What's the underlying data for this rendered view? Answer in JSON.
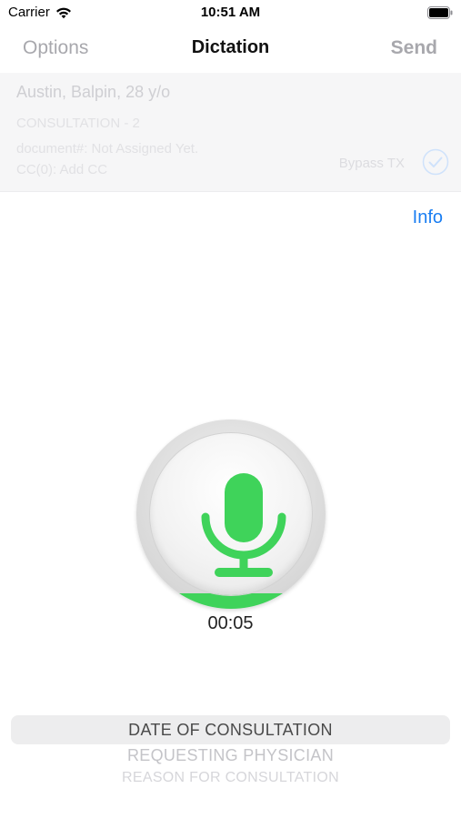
{
  "status_bar": {
    "carrier": "Carrier",
    "time": "10:51 AM"
  },
  "nav": {
    "options_label": "Options",
    "title": "Dictation",
    "send_label": "Send"
  },
  "patient": {
    "name": "Austin, Balpin, 28 y/o",
    "consultation": "CONSULTATION - 2",
    "document": "document#: Not Assigned Yet.",
    "cc": "CC(0): Add CC",
    "bypass_label": "Bypass TX",
    "bypass_checked": true
  },
  "info_label": "Info",
  "recorder": {
    "timer": "00:05",
    "level_percent": 8,
    "accent_color": "#3fd35a"
  },
  "sections": {
    "items": [
      "DATE OF CONSULTATION",
      "REQUESTING PHYSICIAN",
      "REASON FOR CONSULTATION"
    ],
    "selected_index": 0
  },
  "colors": {
    "link_blue": "#1a7ef2",
    "nav_disabled": "#a8a8ad"
  },
  "icons": {
    "wifi": "wifi-icon",
    "battery": "battery-icon",
    "check": "checkmark-circle-icon",
    "mic": "microphone-icon"
  }
}
